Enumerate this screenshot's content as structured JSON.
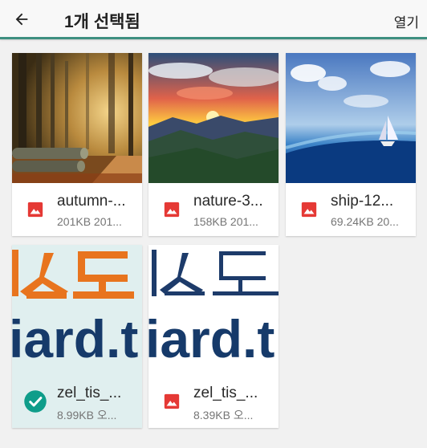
{
  "header": {
    "title": "1개 선택됨",
    "open_label": "열기",
    "icon": "arrow-back-icon",
    "divider_color": "#3e8f80"
  },
  "files": [
    {
      "name": "autumn-...",
      "meta": "201KB 201...",
      "icon": "image-icon",
      "selected": false
    },
    {
      "name": "nature-3...",
      "meta": "158KB 201...",
      "icon": "image-icon",
      "selected": false
    },
    {
      "name": "ship-12...",
      "meta": "69.24KB 20...",
      "icon": "image-icon",
      "selected": false
    },
    {
      "name": "zel_tis_...",
      "meta": "8.99KB 오...",
      "icon": "check-circle-icon",
      "selected": true
    },
    {
      "name": "zel_tis_...",
      "meta": "8.39KB 오...",
      "icon": "image-icon",
      "selected": false
    }
  ],
  "colors": {
    "accent": "#0f9d8a",
    "image_icon": "#e53935",
    "selected_bg": "#e0efef"
  }
}
